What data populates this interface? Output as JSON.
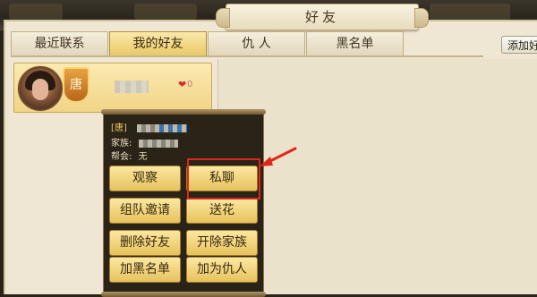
{
  "window": {
    "title": "好友"
  },
  "tabs": [
    {
      "label": "最近联系"
    },
    {
      "label": "我的好友"
    },
    {
      "label": "仇 人"
    },
    {
      "label": "黑名单"
    }
  ],
  "active_tab": "我的好友",
  "add_friend_label": "添加好友",
  "friend": {
    "faction_char": "唐",
    "intimacy": "0"
  },
  "popup": {
    "faction_label": "[唐]",
    "family_label": "家族:",
    "guild_label": "帮会:",
    "guild_value": "无",
    "buttons": {
      "observe": "观察",
      "private_chat": "私聊",
      "team_invite": "组队邀请",
      "send_flower": "送花",
      "delete_friend": "删除好友",
      "expel_family": "开除家族",
      "blacklist": "加黑名单",
      "add_enemy": "加为仇人"
    }
  },
  "colors": {
    "accent_gold": "#e9c868",
    "highlight_red": "#e0261c",
    "heart_red": "#d2302a"
  }
}
